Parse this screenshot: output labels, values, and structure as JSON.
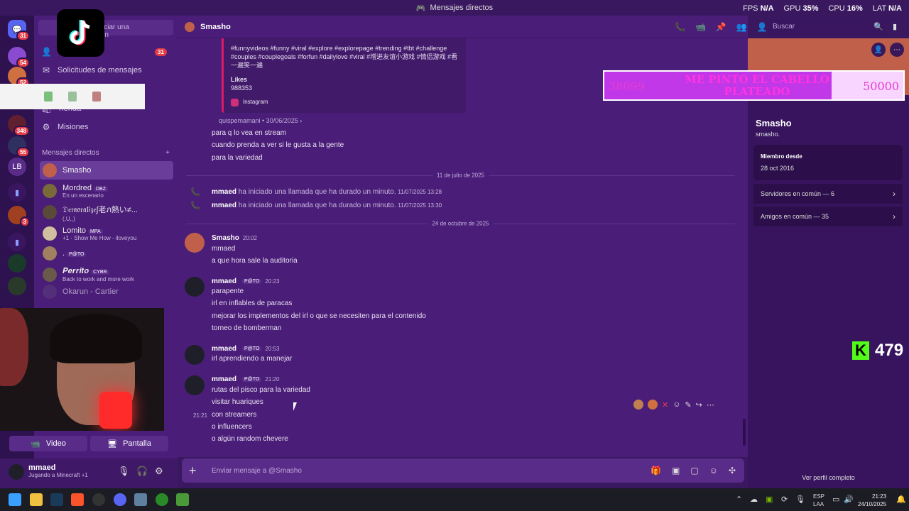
{
  "window": {
    "title": "Mensajes directos"
  },
  "stats": [
    {
      "label": "FPS",
      "value": "N/A"
    },
    {
      "label": "GPU",
      "value": "35%"
    },
    {
      "label": "CPU",
      "value": "16%"
    },
    {
      "label": "LAT",
      "value": "N/A"
    }
  ],
  "guilds": {
    "home_badge": "31",
    "b2": "54",
    "b3": "52",
    "b4": "348",
    "b5": "55",
    "lb": "LB",
    "b6": "3"
  },
  "sidebar": {
    "search_placeholder": "Buscar o iniciar una conversación",
    "friends_badge": "31",
    "message_requests": "Solicitudes de mensajes",
    "shop": "Tienda",
    "missions": "Misiones",
    "dm_header": "Mensajes directos",
    "dm_add": "+",
    "dms": [
      {
        "name": "Smasho",
        "sub": "",
        "tag": ""
      },
      {
        "name": "Mordred",
        "sub": "En un escenario",
        "tag": "DBZ"
      },
      {
        "name": "𝔇𝔢𝔪𝔬𝔯𝔞𝔩𝔦𝔷𝔢∫老ภ熱い≠...",
        "sub": "(,U,,)",
        "tag": ""
      },
      {
        "name": "Lomito",
        "sub": "+1 · Show Me How - iloveyou",
        "tag": "MPA"
      },
      {
        "name": ".",
        "sub": "",
        "tag": "P@TO"
      },
      {
        "name": "𝑷𝒆𝒓𝒓𝒊𝒕𝒐",
        "sub": "Back to work and more work",
        "tag": "CYBR"
      },
      {
        "name": "Okarun - Cartier",
        "sub": "",
        "tag": ""
      }
    ]
  },
  "voice": {
    "video_label": "Video",
    "screen_label": "Pantalla"
  },
  "user": {
    "name": "mmaed",
    "status": "Jugando a Minecraft +1"
  },
  "chat": {
    "recipient": "Smasho",
    "search_placeholder": "Buscar",
    "embed": {
      "tags": "#funnyvideos #funny #viral #explore #explorepage #trending #tbt #challenge #couples #couplegoals #forfun #dailylove #viral #增进友谊小游戏 #情侣游戏 #看一遍笑一遍",
      "likes_label": "Likes",
      "likes_value": "988353",
      "source": "Instagram"
    },
    "embed_meta": "quispemamani • 30/06/2025 ›",
    "early_lines": [
      "para q lo vea en stream",
      "cuando prenda a ver si le gusta a la gente",
      "para la variedad"
    ],
    "date1": "11 de julio de 2025",
    "calls": [
      {
        "user": "mmaed",
        "text": "ha iniciado una llamada que ha durado un minuto.",
        "time": "11/07/2025 13:28"
      },
      {
        "user": "mmaed",
        "text": "ha iniciado una llamada que ha durado un minuto.",
        "time": "11/07/2025 13:30"
      }
    ],
    "date2": "24 de octubre de 2025",
    "messages": [
      {
        "author": "Smasho",
        "tag": "",
        "time": "20:02",
        "lines": [
          "mmaed",
          "a que hora sale la auditoria"
        ]
      },
      {
        "author": "mmaed",
        "tag": "P@TO",
        "time": "20:23",
        "lines": [
          "parapente",
          "irl en inflables de paracas",
          "mejorar los implementos del irl o que se necesiten para el contenido",
          "torneo de bomberman"
        ]
      },
      {
        "author": "mmaed",
        "tag": "P@TO",
        "time": "20:53",
        "lines": [
          "irl aprendiendo a manejar"
        ]
      },
      {
        "author": "mmaed",
        "tag": "P@TO",
        "time": "21:20",
        "lines": [
          "rutas del pisco para la variedad",
          "visitar huariques",
          "con streamers",
          "o influencers",
          "o algún random chevere"
        ]
      }
    ],
    "hover_timestamp": "21:21",
    "composer_placeholder": "Enviar mensaje a @Smasho"
  },
  "profile": {
    "name": "Smasho",
    "username": "smasho.",
    "member_since_label": "Miembro desde",
    "member_since": "28 oct 2016",
    "servers_common": "Servidores en común — 6",
    "friends_common": "Amigos en común — 35",
    "view_full": "Ver perfil completo"
  },
  "overlay": {
    "goal_title": "ME PINTO EL CABELLO PLATEADO",
    "goal_current": "38099",
    "goal_target": "50000",
    "kick_viewers": "479"
  },
  "taskbar": {
    "lang": "ESP",
    "layout": "LAA",
    "time": "21:23",
    "date": "24/10/2025"
  },
  "colors": {
    "bg": "#4a1d78",
    "accent": "#c038e8",
    "kick": "#53fc18",
    "call": "#3ba55d"
  }
}
